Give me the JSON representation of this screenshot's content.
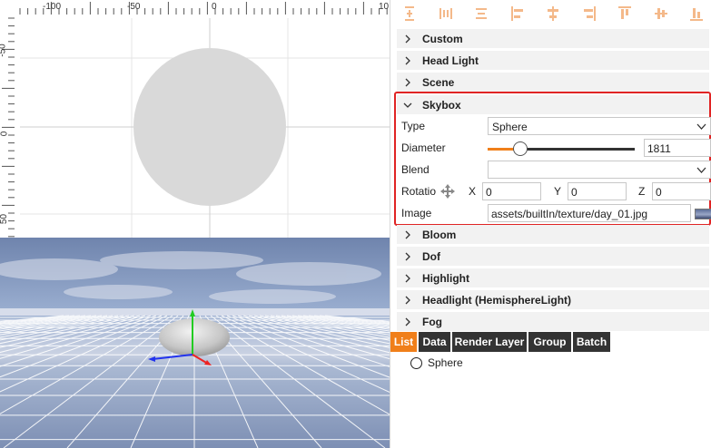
{
  "ruler": {
    "top_labels": [
      "-100",
      "-50",
      "0",
      "10"
    ],
    "left_labels": [
      "-50",
      "0",
      "50"
    ]
  },
  "colors": {
    "accent": "#f07f1a",
    "highlight_border": "#e02424",
    "tab_dark": "#333333",
    "section_bg": "#f2f2f2"
  },
  "toolbar": {
    "icons": [
      "distribute-vertical-icon",
      "distribute-horizontal-icon",
      "align-lines-icon",
      "align-left-icon",
      "align-center-horizontal-icon",
      "align-right-icon",
      "align-top-icon",
      "align-center-vertical-icon",
      "align-bottom-icon"
    ]
  },
  "sections_top": [
    "Custom",
    "Head Light",
    "Scene"
  ],
  "skybox": {
    "title": "Skybox",
    "type_label": "Type",
    "type_value": "Sphere",
    "diameter_label": "Diameter",
    "diameter_value": "1811",
    "diameter_fraction": 0.19,
    "blend_label": "Blend",
    "blend_value": "",
    "rotation_label": "Rotatio",
    "x_label": "X",
    "x_value": "0",
    "y_label": "Y",
    "y_value": "0",
    "z_label": "Z",
    "z_value": "0",
    "image_label": "Image",
    "image_value": "assets/builtIn/texture/day_01.jpg"
  },
  "sections_bottom": [
    "Bloom",
    "Dof",
    "Highlight",
    "Headlight (HemisphereLight)",
    "Fog"
  ],
  "tabs": [
    "List",
    "Data",
    "Render Layer",
    "Group",
    "Batch"
  ],
  "active_tab": "List",
  "list": [
    "Sphere"
  ]
}
